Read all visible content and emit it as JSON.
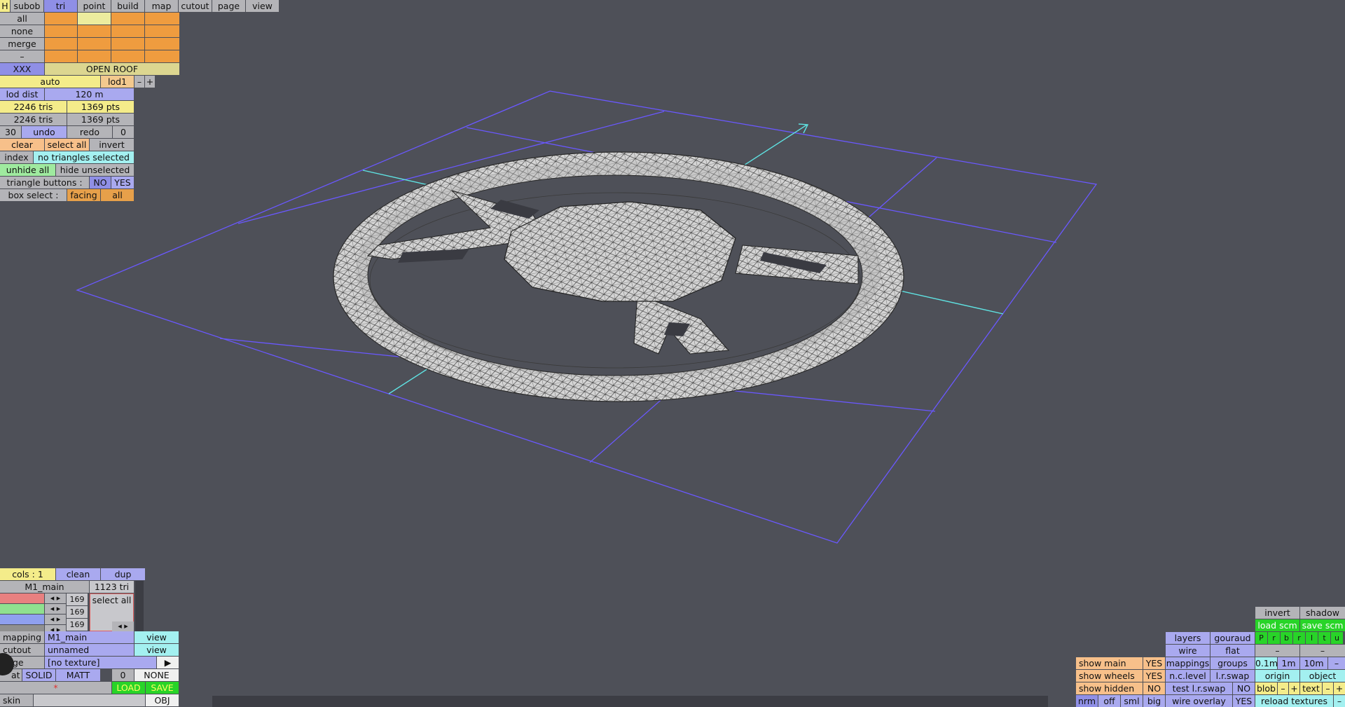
{
  "menu": {
    "h": "H",
    "tabs": [
      "subob",
      "tri",
      "point",
      "build",
      "map",
      "cutout",
      "page",
      "view"
    ]
  },
  "panel_top": {
    "row_labels": [
      "all",
      "none",
      "merge",
      "–"
    ],
    "xxx": "XXX",
    "open_roof": "OPEN ROOF",
    "auto": "auto",
    "lod": "lod1",
    "minus": "–",
    "plus": "+",
    "lod_dist_label": "lod dist",
    "lod_dist": "120 m",
    "tris1": "2246 tris",
    "pts1": "1369 pts",
    "tris2": "2246 tris",
    "pts2": "1369 pts",
    "undo_count": "30",
    "undo": "undo",
    "redo": "redo",
    "redo_count": "0",
    "clear": "clear",
    "select_all": "select all",
    "invert": "invert",
    "index": "index",
    "no_tri": "no triangles selected",
    "unhide_all": "unhide all",
    "hide_unselected": "hide unselected",
    "tri_buttons": "triangle buttons :",
    "no": "NO",
    "yes": "YES",
    "box_select": "box select :",
    "facing": "facing",
    "all": "all"
  },
  "panel_bottom": {
    "cols": "cols : 1",
    "clean": "clean",
    "dup": "dup",
    "material": "M1_main",
    "mat_tri": "1123 tri",
    "channels": [
      "169",
      "169",
      "169"
    ],
    "select_all": "select all",
    "mapping_label": "mapping",
    "mapping_val": "M1_main",
    "view": "view",
    "cutout_label": "cutout",
    "cutout_val": "unnamed",
    "image_label": "ge",
    "image_val": "[no texture]",
    "play": "▶",
    "flat_label": "at",
    "solid": "SOLID",
    "matt": "MATT",
    "zero": "0",
    "none": "NONE",
    "star": "*",
    "load": "LOAD",
    "save": "SAVE",
    "skin": "skin",
    "obj": "OBJ"
  },
  "panel_right": {
    "invert": "invert",
    "shadow": "shadow",
    "load_scm": "load scm",
    "save_scm": "save scm",
    "layers": "layers",
    "gouraud": "gouraud",
    "layer_letters": [
      "P",
      "r",
      "b",
      "r",
      "l",
      "t",
      "u"
    ],
    "wire": "wire",
    "flat": "flat",
    "dash1": "–",
    "dash2": "–",
    "show_main": "show main",
    "show_main_v": "YES",
    "mappings": "mappings",
    "groups": "groups",
    "d01": "0.1m",
    "d1": "1m",
    "d10": "10m",
    "dminus": "–",
    "show_wheels": "show wheels",
    "show_wheels_v": "YES",
    "nc_level": "n.c.level",
    "lr_swap": "l.r.swap",
    "origin": "origin",
    "object": "object",
    "show_hidden": "show hidden",
    "show_hidden_v": "NO",
    "test_lr": "test l.r.swap",
    "test_lr_v": "NO",
    "blob": "blob",
    "bminus": "–",
    "bplus": "+",
    "text": "text",
    "tminus": "–",
    "tplus": "+",
    "nrm": "nrm",
    "off": "off",
    "sml": "sml",
    "big": "big",
    "wire_overlay": "wire overlay",
    "wire_overlay_v": "YES",
    "reload": "reload textures",
    "rminus": "–"
  },
  "colors": {
    "bg": "#4e5058",
    "grid": "#6a58ff",
    "axis": "#5fe3e3",
    "mesh": "#d6d6d6"
  }
}
